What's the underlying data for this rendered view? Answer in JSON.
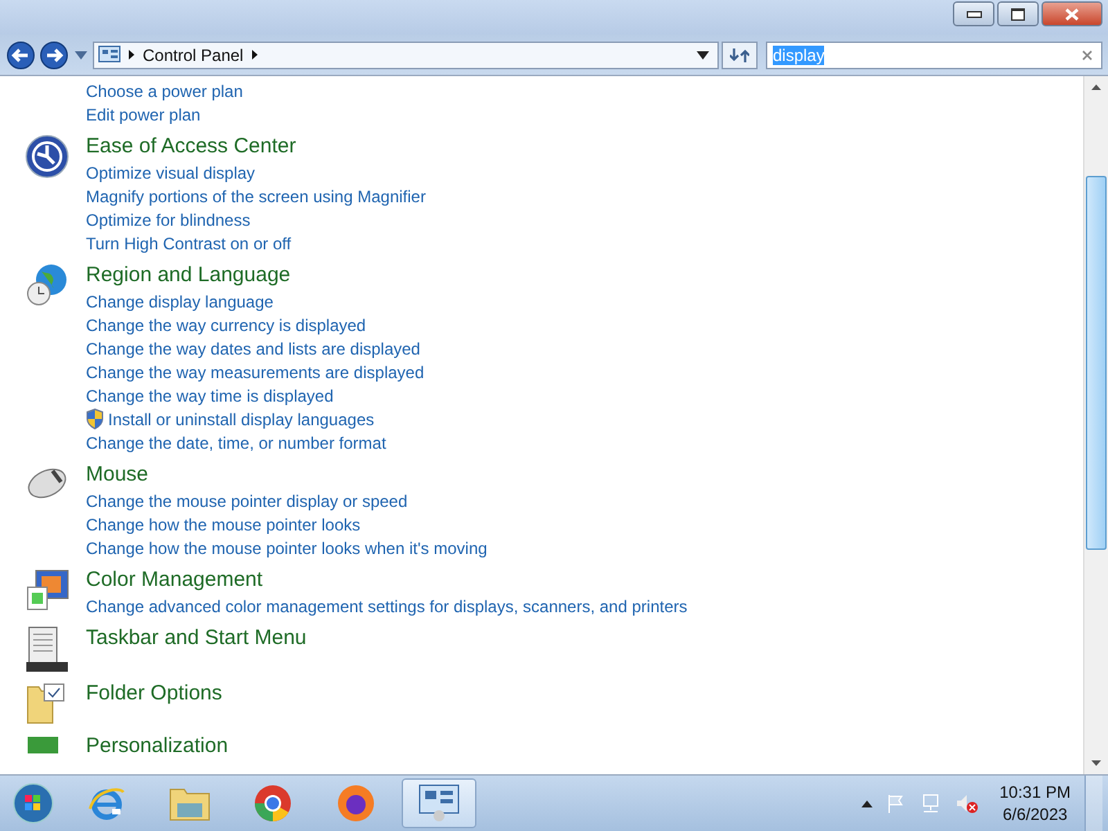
{
  "address_bar": {
    "crumbs": [
      "Control Panel"
    ]
  },
  "search": {
    "value": "display",
    "text_selected": true
  },
  "results": [
    {
      "links": [
        {
          "text": "Choose a power plan",
          "shield": false
        },
        {
          "text": "Edit power plan",
          "shield": false
        }
      ]
    },
    {
      "title": "Ease of Access Center",
      "links": [
        {
          "text": "Optimize visual display",
          "shield": false
        },
        {
          "text": "Magnify portions of the screen using Magnifier",
          "shield": false
        },
        {
          "text": "Optimize for blindness",
          "shield": false
        },
        {
          "text": "Turn High Contrast on or off",
          "shield": false
        }
      ]
    },
    {
      "title": "Region and Language",
      "links": [
        {
          "text": "Change display language",
          "shield": false
        },
        {
          "text": "Change the way currency is displayed",
          "shield": false
        },
        {
          "text": "Change the way dates and lists are displayed",
          "shield": false
        },
        {
          "text": "Change the way measurements are displayed",
          "shield": false
        },
        {
          "text": "Change the way time is displayed",
          "shield": false
        },
        {
          "text": "Install or uninstall display languages",
          "shield": true
        },
        {
          "text": "Change the date, time, or number format",
          "shield": false
        }
      ]
    },
    {
      "title": "Mouse",
      "links": [
        {
          "text": "Change the mouse pointer display or speed",
          "shield": false
        },
        {
          "text": "Change how the mouse pointer looks",
          "shield": false
        },
        {
          "text": "Change how the mouse pointer looks when it's moving",
          "shield": false
        }
      ]
    },
    {
      "title": "Color Management",
      "links": [
        {
          "text": "Change advanced color management settings for displays, scanners, and printers",
          "shield": false
        }
      ]
    },
    {
      "title": "Taskbar and Start Menu"
    },
    {
      "title": "Folder Options"
    },
    {
      "title": "Personalization"
    }
  ],
  "taskbar": {
    "apps": [
      {
        "selected": false
      },
      {
        "selected": false
      },
      {
        "selected": false
      },
      {
        "selected": false
      },
      {
        "selected": true
      }
    ],
    "time": "10:31 PM",
    "date": "6/6/2023"
  }
}
